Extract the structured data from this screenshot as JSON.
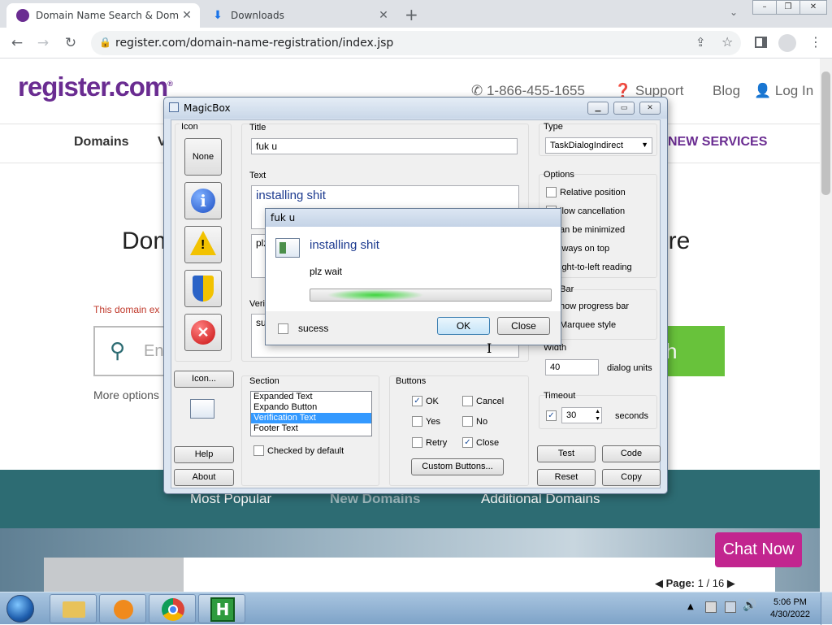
{
  "browser": {
    "tabs": [
      {
        "title": "Domain Name Search & Domain",
        "active": true
      },
      {
        "title": "Downloads",
        "active": false
      }
    ],
    "url": "register.com/domain-name-registration/index.jsp"
  },
  "site": {
    "logo": "register.com",
    "logo_mark": "®",
    "phone": "1-866-455-1655",
    "support": "Support",
    "blog": "Blog",
    "login": "Log In",
    "nav": {
      "domains": "Domains",
      "v": "V",
      "new_services": "NEW SERVICES"
    },
    "headline_left": "Dom",
    "headline_right": "ere",
    "expired_msg": "This domain ex",
    "search_placeholder": "Ent",
    "search_button": "h",
    "more_options": "More options",
    "tabs": [
      "Most Popular",
      "New Domains",
      "Additional Domains"
    ],
    "chat": "Chat Now",
    "pager": {
      "label": "Page:",
      "current": "1",
      "sep": "/",
      "total": "16"
    }
  },
  "magicbox": {
    "title": "MagicBox",
    "icon_group": "Icon",
    "icon_none": "None",
    "icon_browse": "Icon...",
    "help": "Help",
    "about": "About",
    "title_label": "Title",
    "title_value": "fuk u",
    "text_label": "Text",
    "text_value": "installing shit",
    "text2_value": "plz",
    "verification_label": "Veri",
    "verification_value": "su",
    "section_label": "Section",
    "sections": [
      "Expanded Text",
      "Expando Button",
      "Verification Text",
      "Footer Text"
    ],
    "section_selected": "Verification Text",
    "checked_default": "Checked by default",
    "buttons_label": "Buttons",
    "buttons": {
      "ok": "OK",
      "cancel": "Cancel",
      "yes": "Yes",
      "no": "No",
      "retry": "Retry",
      "close": "Close"
    },
    "custom_buttons": "Custom Buttons...",
    "type_label": "Type",
    "type_value": "TaskDialogIndirect",
    "options_label": "Options",
    "options": [
      "Relative position",
      "llow cancellation",
      "an be minimized",
      "lways on top",
      "ight-to-left reading"
    ],
    "progress_label": "ess Bar",
    "progress_options": [
      "how progress bar",
      "Marquee style"
    ],
    "width_label": "Width",
    "width_value": "40",
    "width_unit": "dialog units",
    "timeout_label": "Timeout",
    "timeout_value": "30",
    "timeout_unit": "seconds",
    "test": "Test",
    "code": "Code",
    "reset": "Reset",
    "copy": "Copy"
  },
  "taskdialog": {
    "title": "fuk u",
    "main": "installing shit",
    "content": "plz wait",
    "progress": 0.4,
    "verification": "sucess",
    "ok": "OK",
    "close": "Close"
  },
  "taskbar": {
    "time": "5:06 PM",
    "date": "4/30/2022"
  }
}
